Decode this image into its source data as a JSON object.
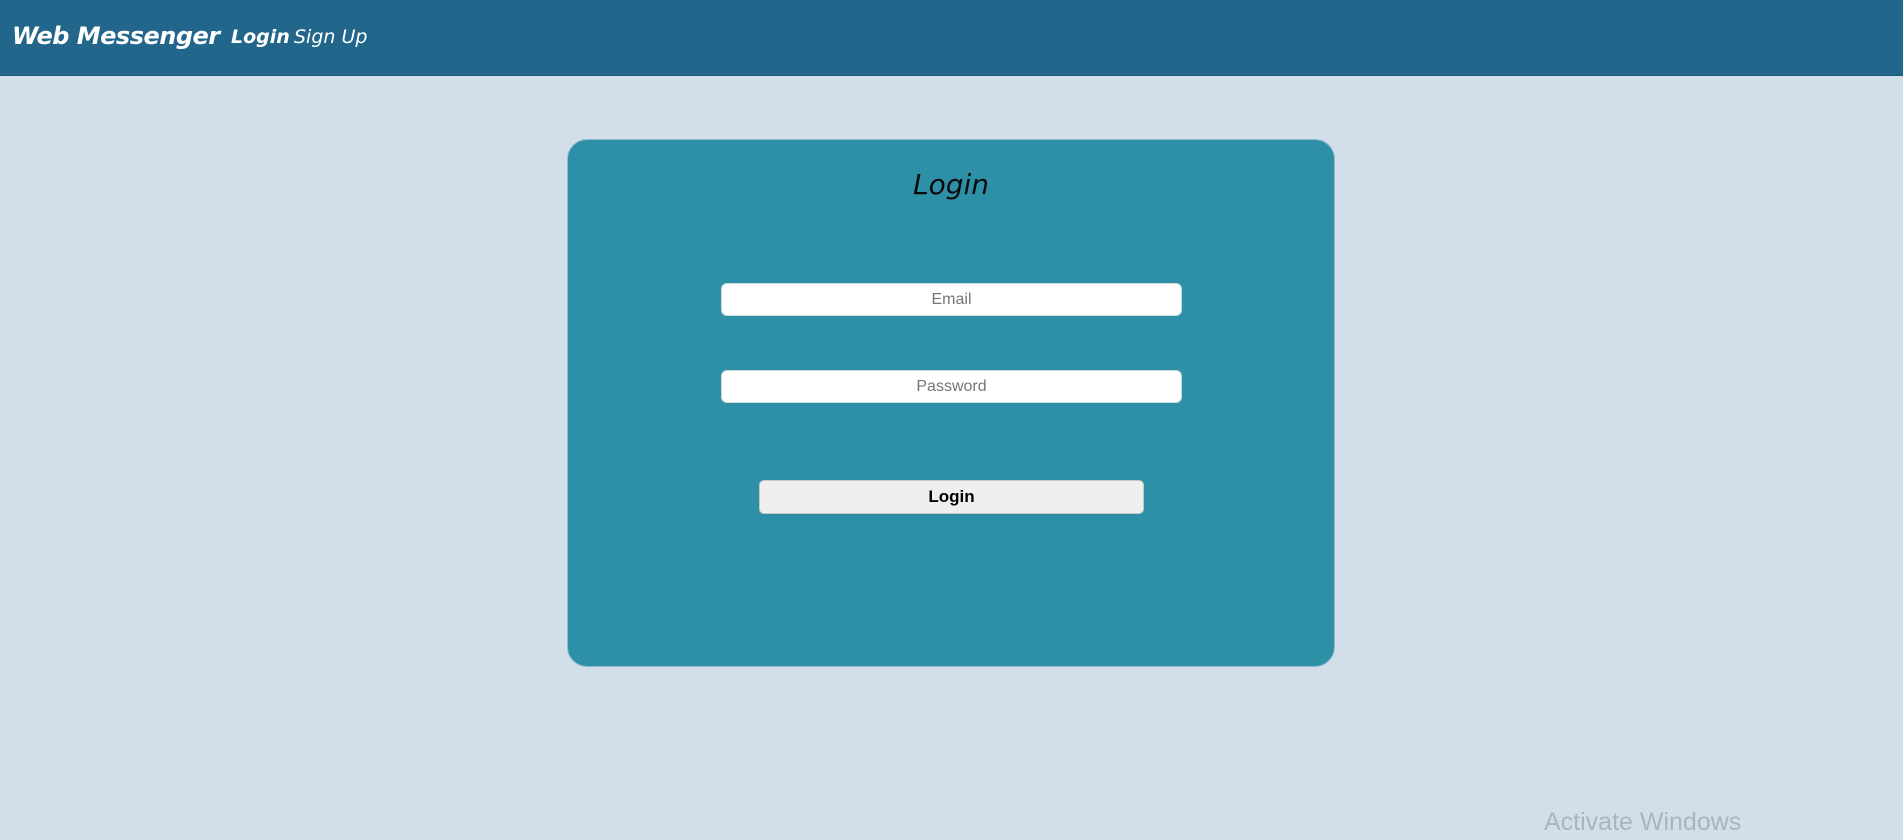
{
  "navbar": {
    "brand": "Web Messenger",
    "links": [
      {
        "label": "Login"
      },
      {
        "label": "Sign Up"
      }
    ],
    "color": "#22668b"
  },
  "login_card": {
    "title": "Login",
    "email_placeholder": "Email",
    "password_placeholder": "Password",
    "submit_label": "Login",
    "background": "#2e90a6"
  },
  "page": {
    "background": "#d2dfea"
  },
  "os_watermark": "Activate Windows"
}
